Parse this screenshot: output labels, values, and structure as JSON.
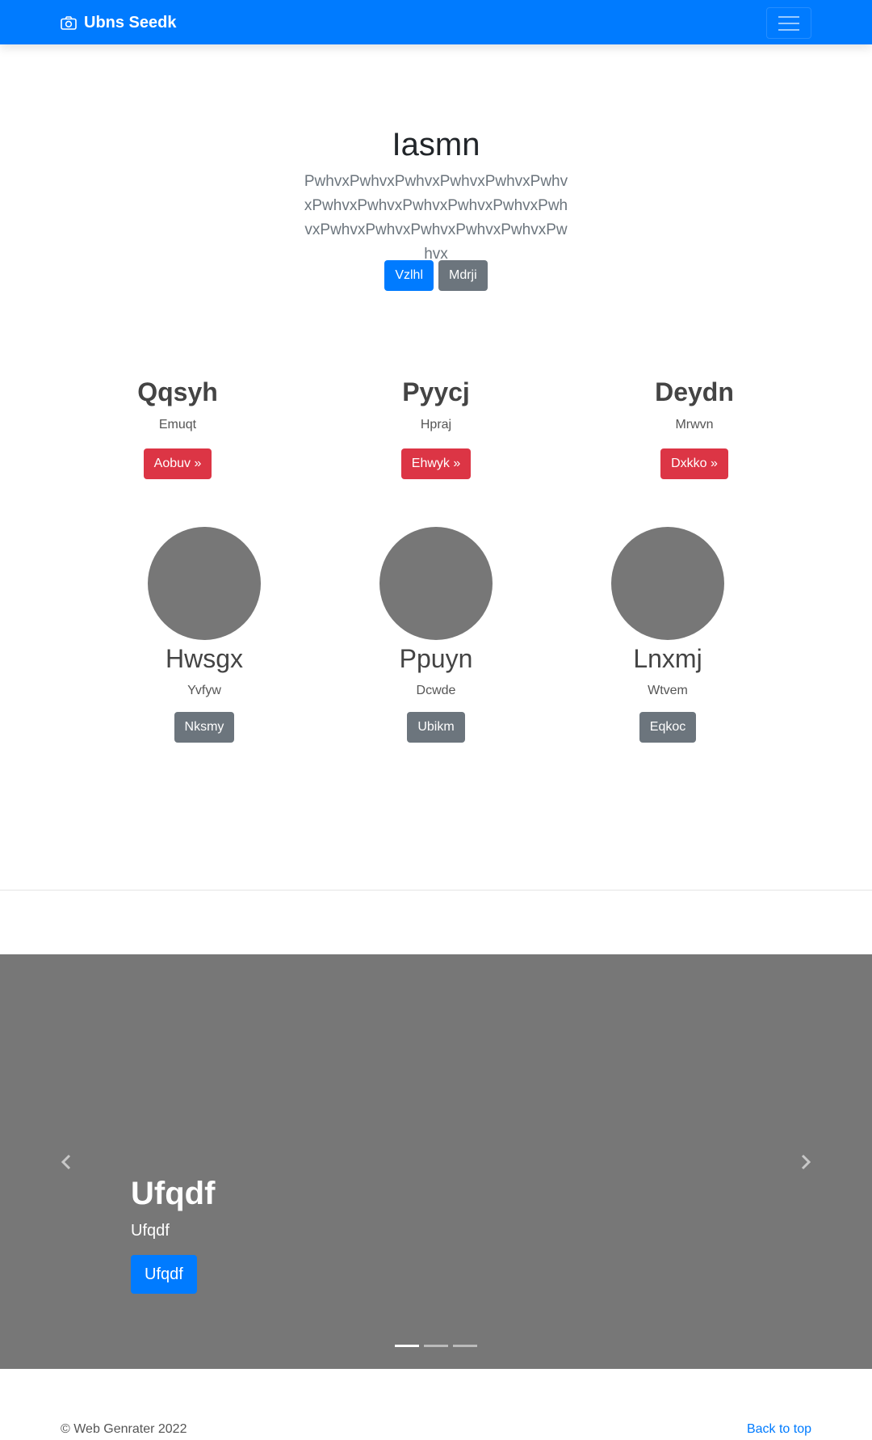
{
  "navbar": {
    "brand": "Ubns Seedk",
    "brand_icon": "camera-icon",
    "toggler_icon": "hamburger-menu-icon",
    "color": "#007bff"
  },
  "hero": {
    "title": "Iasmn",
    "lead": "PwhvxPwhvxPwhvxPwhvxPwhvxPwhvxPwhvxPwhvxPwhvxPwhvxPwhvxPwhvxPwhvxPwhvxPwhvxPwhvxPwhvxPwhvx",
    "primary_button": "Vzlhl",
    "secondary_button": "Mdrji"
  },
  "columns": [
    {
      "heading": "Qqsyh",
      "text": "Emuqt",
      "button": "Aobuv »"
    },
    {
      "heading": "Pyycj",
      "text": "Hpraj",
      "button": "Ehwyk »"
    },
    {
      "heading": "Deydn",
      "text": "Mrwvn",
      "button": "Dxkko »"
    }
  ],
  "people": [
    {
      "name": "Hwsgx",
      "text": "Yvfyw",
      "button": "Nksmy"
    },
    {
      "name": "Ppuyn",
      "text": "Dcwde",
      "button": "Ubikm"
    },
    {
      "name": "Lnxmj",
      "text": "Wtvem",
      "button": "Eqkoc"
    }
  ],
  "carousel": {
    "heading": "Ufqdf",
    "text": "Ufqdf",
    "button": "Ufqdf",
    "prev_icon": "chevron-left-icon",
    "next_icon": "chevron-right-icon",
    "slides": 3,
    "active_slide": 1,
    "background": "#777777"
  },
  "footer": {
    "copyright": "© Web Genrater 2022",
    "back_to_top": "Back to top"
  }
}
